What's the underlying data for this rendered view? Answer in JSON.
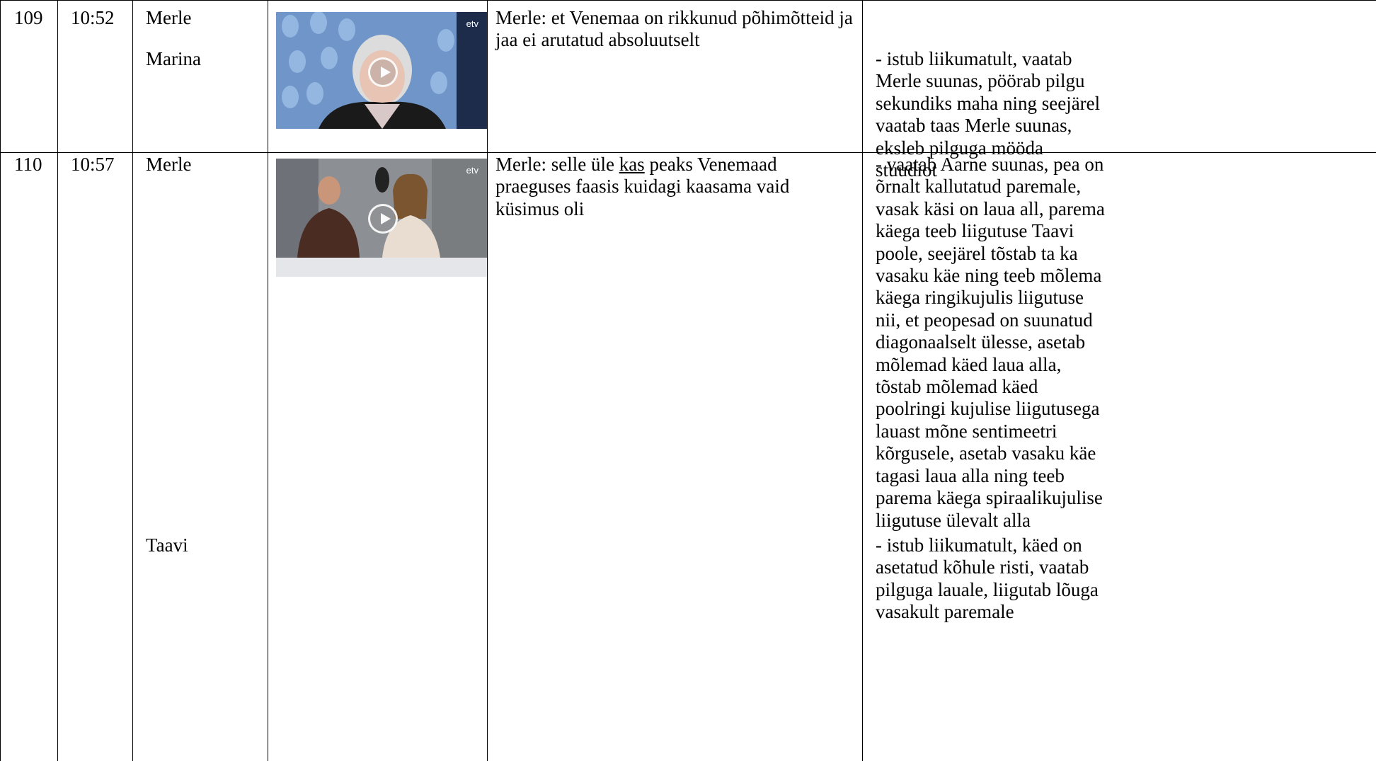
{
  "rows": [
    {
      "num": "109",
      "time": "10:52",
      "speakers": [
        "Merle",
        "Marina"
      ],
      "video_logo": "etv",
      "transcript": "Merle: et Venemaa on rikkunud põhimõtteid ja jaa ei arutatud absoluutselt",
      "notes": [
        "- istub liikumatult, vaatab Merle suunas, pöörab pilgu sekundiks maha ning seejärel vaatab taas Merle suunas, eksleb pilguga mööda stuudiot"
      ]
    },
    {
      "num": "110",
      "time": "10:57",
      "speakers": [
        "Merle",
        "Taavi"
      ],
      "video_logo": "etv",
      "transcript_pre": "Merle: selle üle ",
      "transcript_underlined": "kas",
      "transcript_post": " peaks Venemaad praeguses faasis kuidagi kaasama vaid küsimus oli",
      "notes": [
        "- vaatab Aarne suunas, pea on õrnalt kallutatud paremale, vasak käsi on laua all, parema käega teeb liigutuse Taavi poole, seejärel tõstab ta ka vasaku käe ning teeb mõlema käega ringikujulis liigutuse nii, et peopesad on suunatud diagonaalselt ülesse, asetab mõlemad käed laua alla, tõstab mõlemad käed poolringi kujulise liigutusega lauast mõne sentimeetri kõrgusele, asetab vasaku käe tagasi laua alla ning teeb parema käega spiraalikujulise liigutuse ülevalt alla",
        "- istub liikumatult, käed on asetatud kõhule risti, vaatab pilguga lauale, liigutab lõuga vasakult paremale"
      ]
    }
  ]
}
